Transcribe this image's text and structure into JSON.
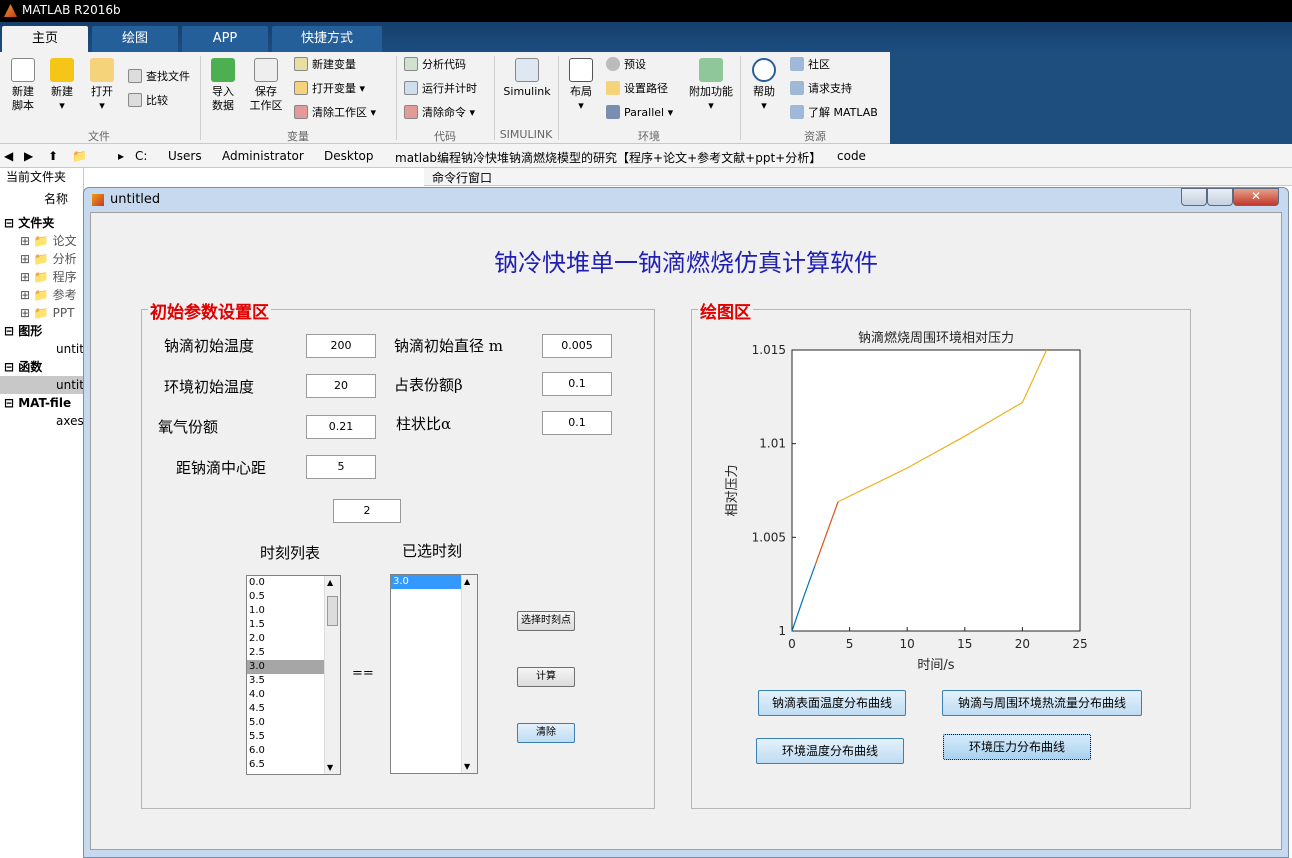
{
  "app_title": "MATLAB R2016b",
  "tabs": [
    "主页",
    "绘图",
    "APP",
    "快捷方式"
  ],
  "ribbon": {
    "new_script": "新建\n脚本",
    "new": "新建",
    "open": "打开",
    "find_files": "查找文件",
    "compare": "比较",
    "import_data": "导入\n数据",
    "save_workspace": "保存\n工作区",
    "new_variable": "新建变量",
    "open_variable": "打开变量",
    "clear_workspace": "清除工作区",
    "analyze_code": "分析代码",
    "run_and_time": "运行并计时",
    "clear_commands": "清除命令",
    "simulink": "Simulink",
    "layout": "布局",
    "preferences": "预设",
    "set_path": "设置路径",
    "parallel": "Parallel",
    "addons": "附加功能",
    "help": "帮助",
    "community": "社区",
    "request_support": "请求支持",
    "learn_matlab": "了解 MATLAB",
    "groups": [
      "文件",
      "变量",
      "代码",
      "SIMULINK",
      "环境",
      "资源"
    ]
  },
  "address": [
    "C:",
    "Users",
    "Administrator",
    "Desktop",
    "matlab编程钠冷快堆钠滴燃烧模型的研究【程序+论文+参考文献+ppt+分析】",
    "code"
  ],
  "left_panel": {
    "header": "当前文件夹",
    "col_name": "名称",
    "folder_group": "文件夹",
    "folders": [
      "论文",
      "分析",
      "程序",
      "参考",
      "PPT"
    ],
    "fig_group": "图形",
    "fig_item": "untit",
    "func_group": "函数",
    "func_item": "untit",
    "mat_group": "MAT-file",
    "mat_item": "axes"
  },
  "cmd_window": "命令行窗口",
  "figure": {
    "title": "untitled",
    "main_title": "钠冷快堆单一钠滴燃烧仿真计算软件",
    "params_title": "初始参数设置区",
    "plot_title": "绘图区",
    "labels": {
      "init_temp": "钠滴初始温度",
      "env_temp": "环境初始温度",
      "oxygen": "氧气份额",
      "distance": "距钠滴中心距",
      "init_diam": "钠滴初始直径 m",
      "surface_frac": "占表份额β",
      "ratio": "柱状比α"
    },
    "values": {
      "init_temp": "200",
      "env_temp": "20",
      "oxygen": "0.21",
      "distance": "5",
      "init_diam": "0.005",
      "surface_frac": "0.1",
      "ratio": "0.1",
      "count": "2"
    },
    "time_list_label": "时刻列表",
    "selected_label": "已选时刻",
    "time_list": [
      "0.0",
      "0.5",
      "1.0",
      "1.5",
      "2.0",
      "2.5",
      "3.0",
      "3.5",
      "4.0",
      "4.5",
      "5.0",
      "5.5",
      "6.0",
      "6.5"
    ],
    "time_list_selected": "3.0",
    "selected_list": [
      "3.0"
    ],
    "eq": "==",
    "buttons": {
      "select": "选择时刻点",
      "compute": "计算",
      "clear": "清除",
      "surface_temp": "钠滴表面温度分布曲线",
      "heat_flux": "钠滴与周围环境热流量分布曲线",
      "env_temp": "环境温度分布曲线",
      "env_pressure": "环境压力分布曲线"
    }
  },
  "chart_data": {
    "type": "line",
    "title": "钠滴燃烧周围环境相对压力",
    "xlabel": "时间/s",
    "ylabel": "相对压力",
    "xlim": [
      0,
      25
    ],
    "ylim": [
      1,
      1.015
    ],
    "xticks": [
      "0",
      "5",
      "10",
      "15",
      "20",
      "25"
    ],
    "yticks": [
      "1",
      "1.005",
      "1.01",
      "1.015"
    ],
    "series": [
      {
        "color": "#0072bd",
        "x": [
          0,
          1,
          2
        ],
        "y": [
          1.0,
          1.0018,
          1.0035
        ]
      },
      {
        "color": "#d95319",
        "x": [
          2,
          3,
          4
        ],
        "y": [
          1.0035,
          1.0052,
          1.0069
        ]
      },
      {
        "color": "#edb120",
        "x": [
          4,
          10,
          15,
          20,
          22.1
        ],
        "y": [
          1.0069,
          1.0087,
          1.0104,
          1.0122,
          1.015
        ]
      }
    ]
  }
}
